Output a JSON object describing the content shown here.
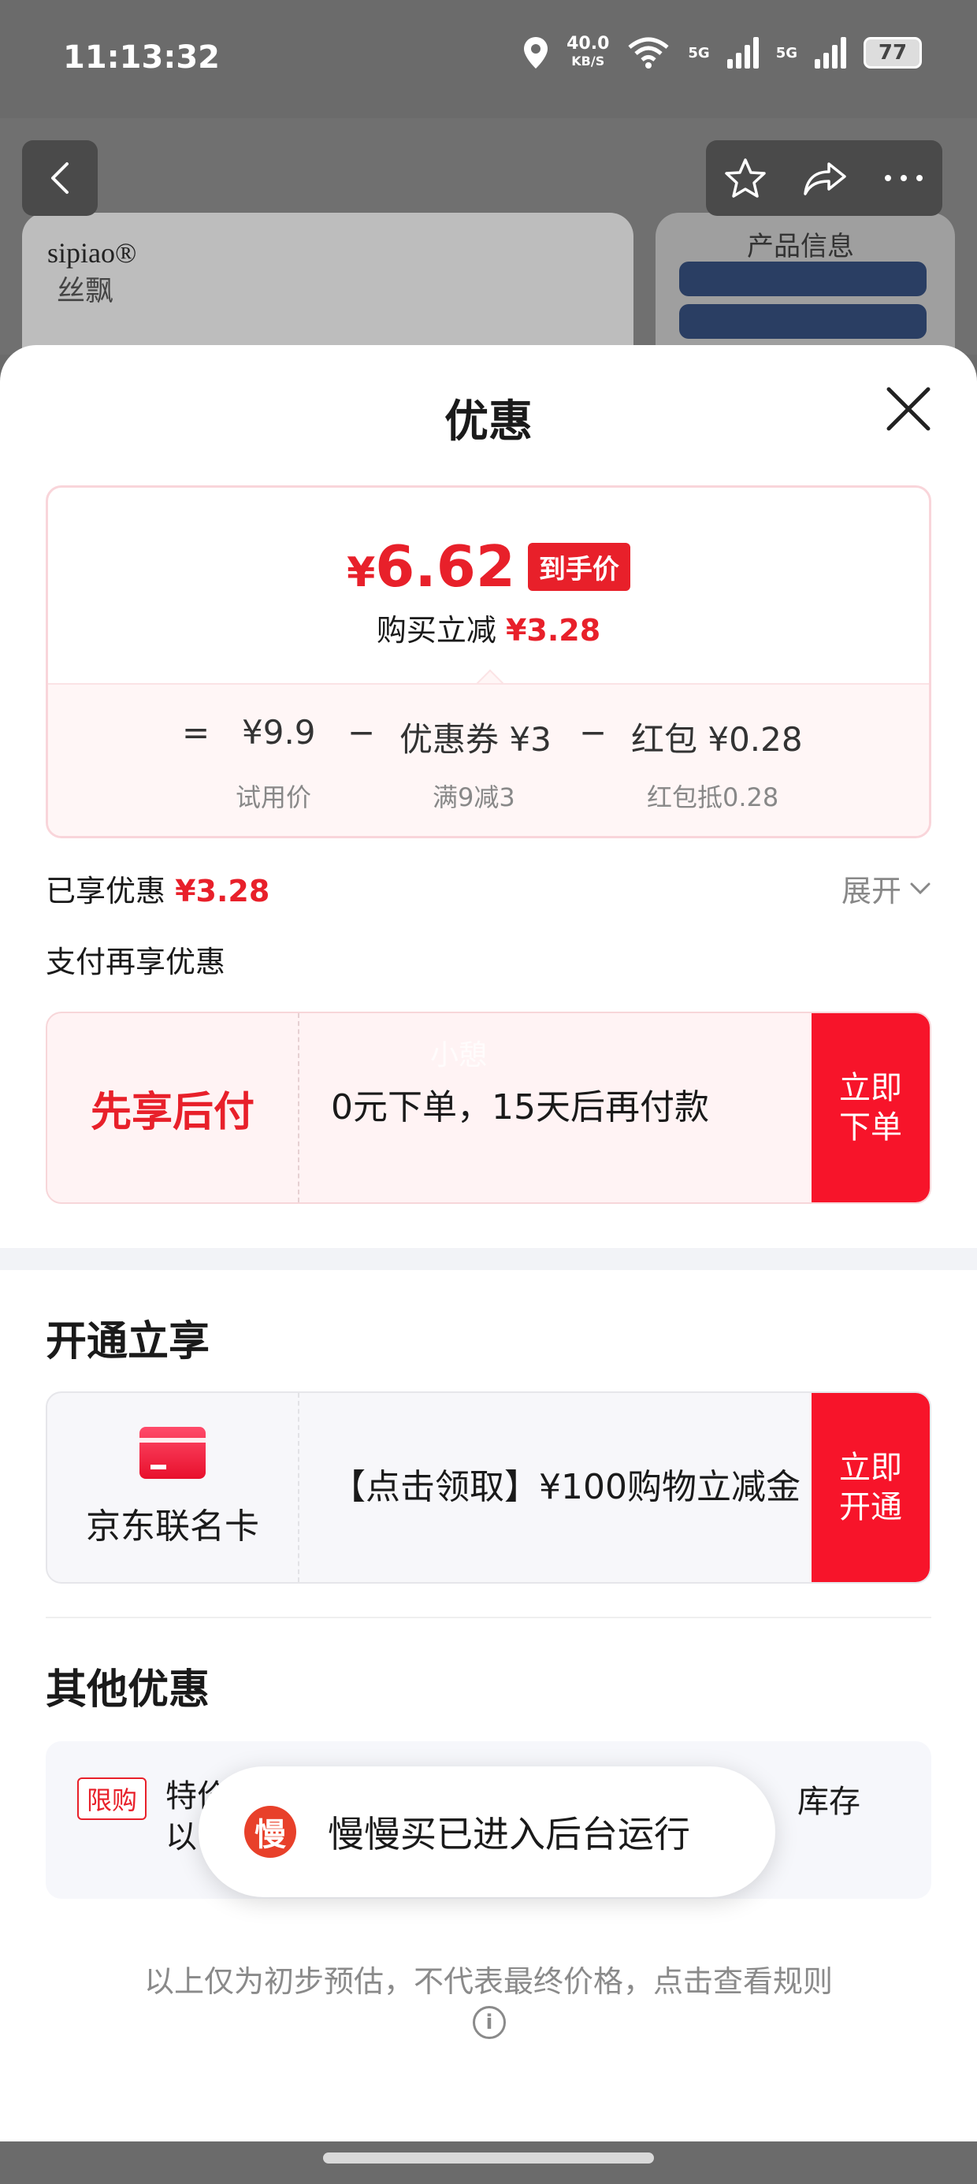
{
  "status_bar": {
    "time": "11:13:32",
    "net_speed": "40.0",
    "net_unit": "KB/S",
    "signal1": "5G",
    "signal2": "5G",
    "battery": "77"
  },
  "product_bg": {
    "brand": "sipiao®",
    "brand_cn": "丝飘",
    "info_title": "产品信息"
  },
  "sheet": {
    "title": "优惠",
    "price": {
      "currency": "¥",
      "amount": "6.62",
      "tag": "到手价",
      "reduce_label": "购买立减",
      "reduce_amount": "¥3.28"
    },
    "formula": {
      "eq": "=",
      "trial_price": "¥9.9",
      "minus1": "−",
      "coupon": "优惠券 ¥3",
      "minus2": "−",
      "redpacket": "红包 ¥0.28",
      "trial_label": "试用价",
      "coupon_label": "满9减3",
      "redpacket_label": "红包抵0.28"
    },
    "enjoyed_label": "已享优惠",
    "enjoyed_amount": "¥3.28",
    "expand_label": "展开",
    "pay_more_label": "支付再享优惠",
    "bnpl": {
      "title": "先享后付",
      "desc": "0元下单，15天后再付款",
      "button": "立即下单",
      "watermark": "小憩"
    },
    "open_section_title": "开通立享",
    "card_offer": {
      "name": "京东联名卡",
      "desc": "【点击领取】¥100购物立减金",
      "button": "立即开通"
    },
    "other_section_title": "其他优惠",
    "other_offer": {
      "badge": "限购",
      "text_left": "特价\n以",
      "text_right": "库存"
    },
    "toast": {
      "icon_char": "慢",
      "text": "慢慢买已进入后台运行"
    },
    "footnote": "以上仅为初步预估，不代表最终价格，点击查看规则"
  },
  "colors": {
    "accent": "#e8202a",
    "button_red": "#f7142a"
  }
}
